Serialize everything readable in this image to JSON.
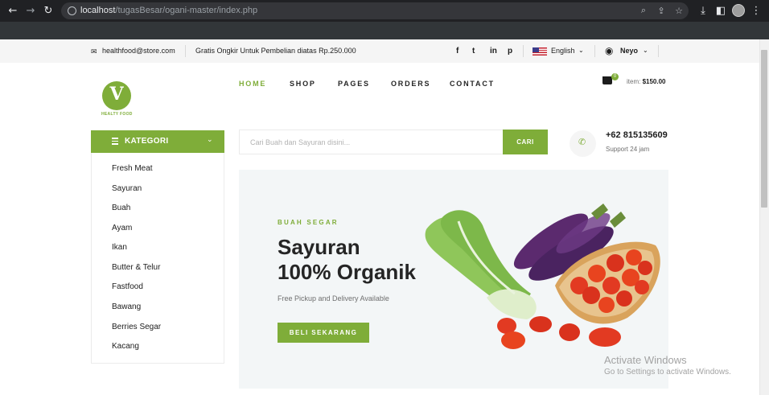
{
  "browser": {
    "url_host": "localhost",
    "url_path": "/tugasBesar/ogani-master/index.php"
  },
  "topbar": {
    "email": "healthfood@store.com",
    "promo": "Gratis Ongkir Untuk Pembelian diatas Rp.250.000",
    "social": [
      "f",
      "t",
      "in",
      "p"
    ],
    "language": "English",
    "user": "Neyo"
  },
  "logo": {
    "text": "HEALTY FOOD",
    "letter": "V"
  },
  "nav": {
    "items": [
      "HOME",
      "SHOP",
      "PAGES",
      "ORDERS",
      "CONTACT"
    ],
    "active": "HOME"
  },
  "cart": {
    "count": "0",
    "label": "item:",
    "total": "$150.00"
  },
  "kategori": {
    "title": "KATEGORI",
    "items": [
      "Fresh Meat",
      "Sayuran",
      "Buah",
      "Ayam",
      "Ikan",
      "Butter & Telur",
      "Fastfood",
      "Bawang",
      "Berries Segar",
      "Kacang"
    ]
  },
  "search": {
    "placeholder": "Cari Buah dan Sayuran disini...",
    "button": "CARI"
  },
  "phone": {
    "number": "+62 815135609",
    "support": "Support 24 jam"
  },
  "hero": {
    "kicker": "BUAH SEGAR",
    "title_line1": "Sayuran",
    "title_line2": "100% Organik",
    "subtitle": "Free Pickup and Delivery Available",
    "button": "BELI SEKARANG"
  },
  "watermark": {
    "title": "Activate Windows",
    "subtitle": "Go to Settings to activate Windows."
  },
  "colors": {
    "accent": "#7fad39",
    "dark_text": "#252525"
  }
}
